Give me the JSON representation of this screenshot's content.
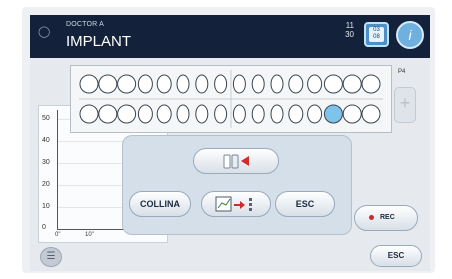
{
  "header": {
    "doctor": "DOCTOR A",
    "title": "IMPLANT",
    "time_hour": "11",
    "time_minute": "30",
    "date_top": "03",
    "date_bottom": "08",
    "info_label": "i"
  },
  "graph": {
    "y_ticks": [
      "50",
      "40",
      "30",
      "20",
      "10",
      "0"
    ],
    "x_ticks": [
      "0\"",
      "10\""
    ]
  },
  "teeth_chart": {
    "label": "P4"
  },
  "controls": {
    "collina_label": "COLLINA",
    "esc_label": "ESC",
    "rec_label": "REC",
    "esc_bottom_label": "ESC"
  },
  "colors": {
    "header_bg": "#14213a",
    "accent": "#4f8fc8",
    "selected_tooth": "#7ec3ea",
    "rec_dot": "#d1272a",
    "mode_arrow": "#d32a2a"
  }
}
